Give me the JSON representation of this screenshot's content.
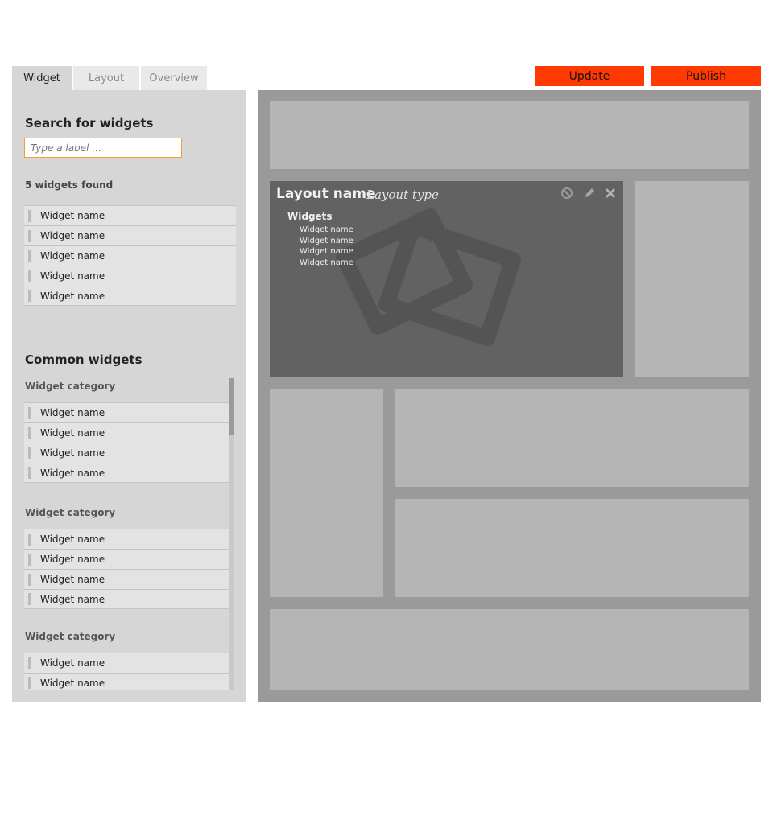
{
  "tabs": [
    {
      "label": "Widget",
      "active": true
    },
    {
      "label": "Layout",
      "active": false
    },
    {
      "label": "Overview",
      "active": false
    }
  ],
  "actions": {
    "update_label": "Update",
    "publish_label": "Publish",
    "accent": "#ff3a00"
  },
  "search": {
    "title": "Search for widgets",
    "placeholder": "Type a label …",
    "value": "",
    "found_text": "5 widgets found",
    "results": [
      "Widget name",
      "Widget name",
      "Widget name",
      "Widget name",
      "Widget name"
    ]
  },
  "common": {
    "title": "Common widgets",
    "categories": [
      {
        "label": "Widget category",
        "widgets": [
          "Widget name",
          "Widget name",
          "Widget name",
          "Widget name"
        ]
      },
      {
        "label": "Widget category",
        "widgets": [
          "Widget name",
          "Widget name",
          "Widget name",
          "Widget name"
        ]
      },
      {
        "label": "Widget category",
        "widgets": [
          "Widget name",
          "Widget name"
        ]
      }
    ]
  },
  "layout_card": {
    "name": "Layout name",
    "type": "Layout type",
    "icons": [
      "disable-icon",
      "edit-icon",
      "close-icon"
    ],
    "widgets_label": "Widgets",
    "widgets": [
      "Widget name",
      "Widget name",
      "Widget name",
      "Widget name"
    ]
  }
}
